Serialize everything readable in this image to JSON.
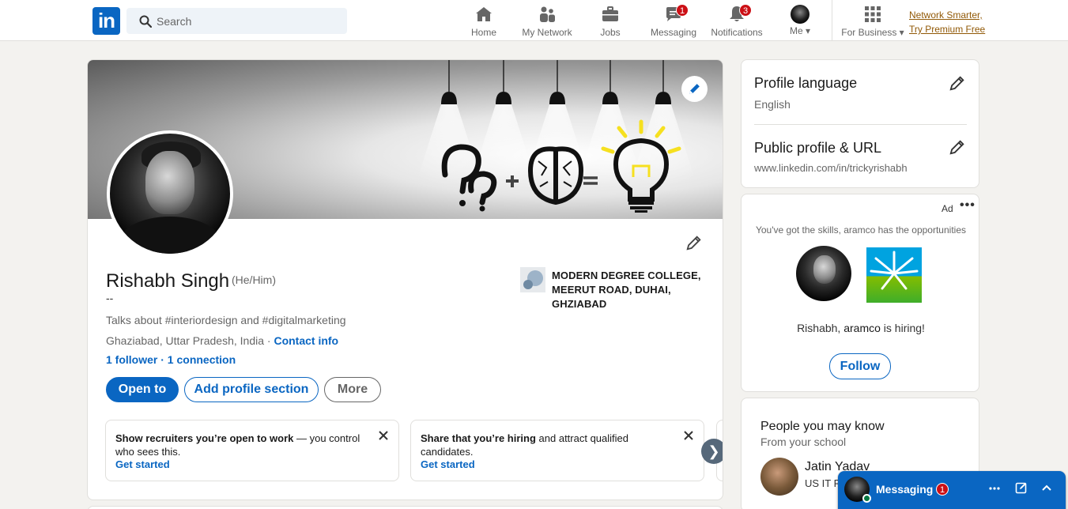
{
  "nav": {
    "search_placeholder": "Search",
    "items": [
      {
        "label": "Home",
        "badge": ""
      },
      {
        "label": "My Network",
        "badge": ""
      },
      {
        "label": "Jobs",
        "badge": ""
      },
      {
        "label": "Messaging",
        "badge": "1"
      },
      {
        "label": "Notifications",
        "badge": "3"
      },
      {
        "label": "Me",
        "badge": ""
      },
      {
        "label": "For Business",
        "badge": ""
      }
    ],
    "premium_line1": "Network Smarter,",
    "premium_line2": "Try Premium Free",
    "logo_text": "in"
  },
  "profile": {
    "name": "Rishabh Singh",
    "pronouns": "(He/Him)",
    "dash": "--",
    "headline": "Talks about #interiordesign and #digitalmarketing",
    "location": "Ghaziabad, Uttar Pradesh, India · ",
    "contact_info": "Contact info",
    "followers": "1 follower",
    "connections": " · 1 connection",
    "education": "MODERN DEGREE COLLEGE, MEERUT ROAD, DUHAI, GHZIABAD",
    "buttons": {
      "open_to": "Open to",
      "add_section": "Add profile section",
      "more": "More"
    },
    "promos": [
      {
        "bold": "Show recruiters you’re open to work",
        "rest": " — you control who sees this.",
        "cta": "Get started"
      },
      {
        "bold": "Share that you’re hiring",
        "rest": " and attract qualified candidates.",
        "cta": "Get started"
      }
    ],
    "carousel_next": "❯"
  },
  "sidebar": {
    "profile_language": {
      "title": "Profile language",
      "value": "English"
    },
    "public_profile": {
      "title": "Public profile & URL",
      "value": "www.linkedin.com/in/trickyrishabh"
    }
  },
  "ad": {
    "label": "Ad",
    "menu": "•••",
    "tagline": "You've got the skills, aramco has the opportunities",
    "hiring_prefix": "Rishabh, ",
    "company": "aramco",
    "hiring_suffix": " is hiring!",
    "follow": "Follow"
  },
  "pymk": {
    "title": "People you may know",
    "subtitle": "From your school",
    "person_name": "Jatin Yadav",
    "person_role": "US IT R"
  },
  "messaging": {
    "title": "Messaging",
    "badge": "1"
  },
  "colors": {
    "brand": "#0a66c2",
    "badge": "#cc1016",
    "premium": "#915907",
    "background": "#f3f2ef"
  },
  "icons": [
    "linkedin-logo-icon",
    "search-icon",
    "home-icon",
    "my-network-icon",
    "jobs-icon",
    "messaging-icon",
    "notifications-icon",
    "grid-icon",
    "pencil-icon",
    "close-icon",
    "chevron-right-icon",
    "ellipsis-icon",
    "compose-icon",
    "chevron-up-icon"
  ]
}
